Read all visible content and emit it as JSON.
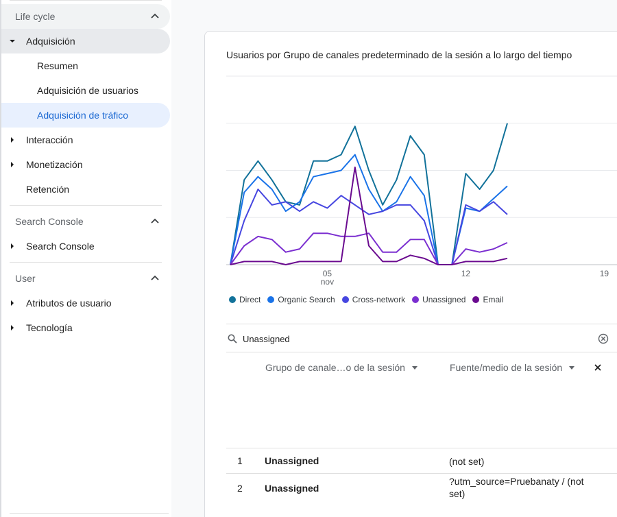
{
  "sidebar": {
    "lifecycle_header": "Life cycle",
    "acquisition": "Adquisición",
    "summary": "Resumen",
    "user_acquisition": "Adquisición de usuarios",
    "traffic_acquisition": "Adquisición de tráfico",
    "engagement": "Interacción",
    "monetization": "Monetización",
    "retention": "Retención",
    "search_console_header": "Search Console",
    "search_console_item": "Search Console",
    "user_header": "User",
    "user_attributes": "Atributos de usuario",
    "technology": "Tecnología"
  },
  "card": {
    "title": "Usuarios por Grupo de canales predeterminado de la sesión a lo largo del tiempo"
  },
  "chart_data": {
    "type": "line",
    "x_tick_labels": [
      {
        "label": "05",
        "sublabel": "nov",
        "index": 7
      },
      {
        "label": "12",
        "index": 17
      },
      {
        "label": "19",
        "index": 27
      }
    ],
    "series": [
      {
        "name": "Direct",
        "color": "#12729a",
        "values": [
          0,
          27,
          33,
          27,
          20,
          19,
          33,
          33,
          35,
          44,
          30,
          19,
          27,
          41,
          35,
          0,
          0,
          29,
          24,
          30,
          45
        ]
      },
      {
        "name": "Organic Search",
        "color": "#1a73e8",
        "values": [
          0,
          23,
          28,
          24,
          17,
          20,
          28,
          29,
          30,
          35,
          24,
          17,
          20,
          28,
          22,
          0,
          0,
          18,
          17,
          21,
          25
        ]
      },
      {
        "name": "Cross-network",
        "color": "#4646e0",
        "values": [
          0,
          14,
          24,
          19,
          20,
          17,
          20,
          18,
          22,
          19,
          16,
          17,
          19,
          19,
          14,
          0,
          0,
          19,
          17,
          20,
          16
        ]
      },
      {
        "name": "Unassigned",
        "color": "#7b2fd0",
        "values": [
          0,
          6,
          9,
          8,
          4,
          5,
          10,
          10,
          9,
          9,
          10,
          4,
          4,
          8,
          8,
          0,
          0,
          5,
          4,
          5,
          7
        ]
      },
      {
        "name": "Email",
        "color": "#6a0a8f",
        "values": [
          0,
          1,
          1,
          1,
          0,
          1,
          1,
          1,
          1,
          31,
          6,
          1,
          1,
          3,
          2,
          0,
          0,
          1,
          1,
          1,
          2
        ]
      }
    ],
    "ylim": [
      0,
      60
    ],
    "grid": true
  },
  "search": {
    "value": "Unassigned"
  },
  "table": {
    "dim1_header": "Grupo de canale…o de la sesión",
    "dim2_header": "Fuente/medio de la sesión",
    "rows": [
      {
        "idx": "1",
        "channel": "Unassigned",
        "source": "(not set)"
      },
      {
        "idx": "2",
        "channel": "Unassigned",
        "source": "?utm_source=Pruebanaty / (not set)"
      }
    ]
  }
}
